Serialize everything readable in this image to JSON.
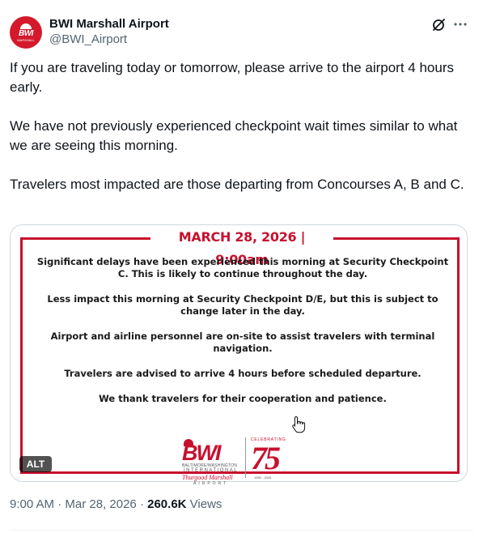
{
  "author": {
    "display_name": "BWI Marshall Airport",
    "handle": "@BWI_Airport",
    "avatar_text": "BWI",
    "avatar_subtext": "MARSHALL"
  },
  "tweet": {
    "paragraphs": [
      "If you are traveling today or tomorrow, please arrive to the airport 4 hours early.",
      "We have not previously experienced checkpoint wait times similar to what we are seeing this morning.",
      "Travelers most impacted are those departing from Concourses A, B and C."
    ]
  },
  "media": {
    "header": "MARCH 28, 2026 | 9:00am",
    "lines": [
      "Significant delays have been experienced this morning at Security Checkpoint C. This is likely to continue throughout the day.",
      "Less impact this morning at Security Checkpoint D/E, but this is subject to change later in the day.",
      "Airport and airline personnel are on-site to assist travelers with terminal navigation.",
      "Travelers are advised to arrive 4 hours before scheduled departure.",
      "We thank travelers for their cooperation and patience."
    ],
    "logo": {
      "main": "BWI",
      "line1": "BALTIMORE/WASHINGTON",
      "line2": "INTERNATIONAL",
      "line3": "Thurgood Marshall",
      "line4": "AIRPORT"
    },
    "anniversary": {
      "label": "CELEBRATING",
      "number": "75",
      "years": "1950 - 2025"
    },
    "alt_badge": "ALT"
  },
  "meta": {
    "time": "9:00 AM",
    "separator": "·",
    "date": "Mar 28, 2026",
    "views_count": "260.6K",
    "views_label": "Views"
  },
  "icons": {
    "grok": "grok-icon",
    "more": "more-icon",
    "cursor": "hand-cursor-icon"
  },
  "colors": {
    "brand_red": "#c8102e",
    "text_primary": "#0f1419",
    "text_secondary": "#536471"
  }
}
